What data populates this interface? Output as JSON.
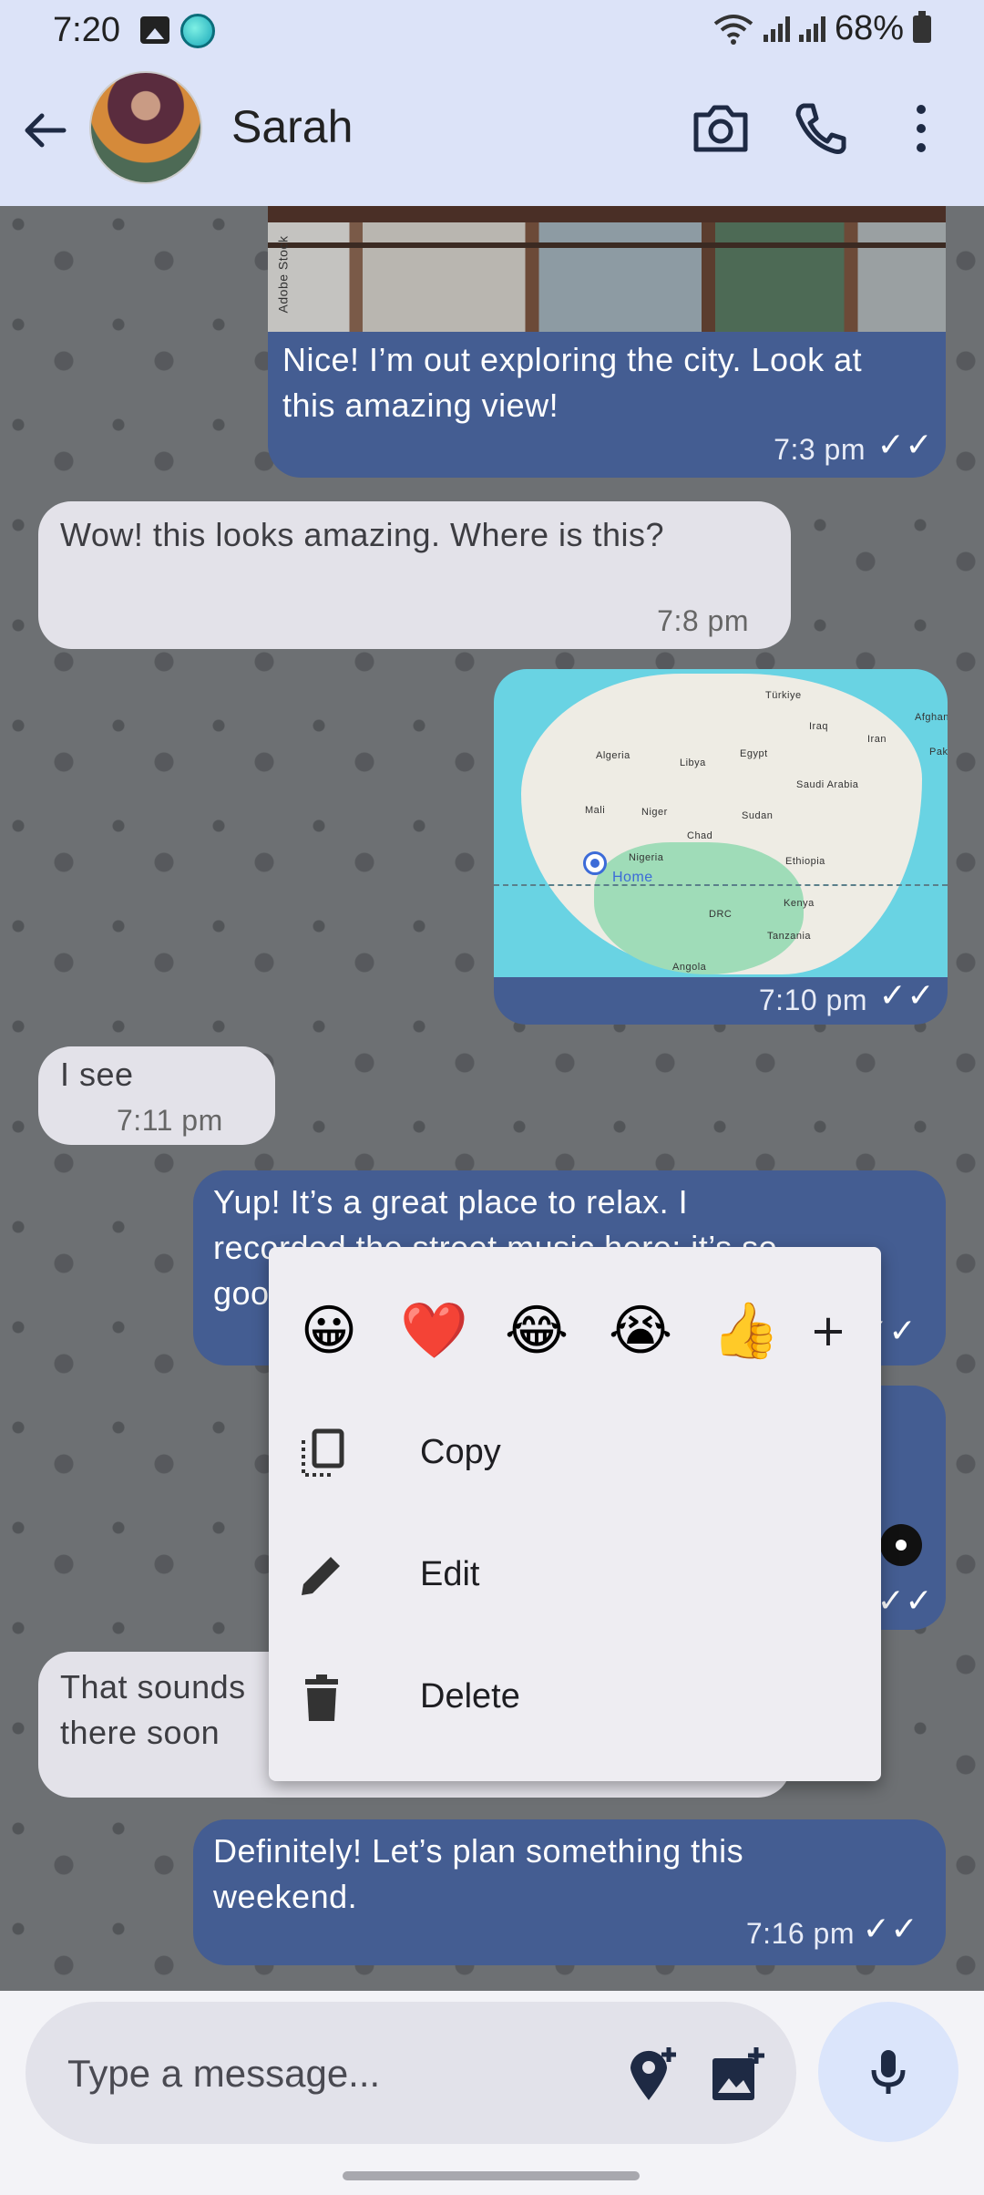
{
  "status_bar": {
    "time": "7:20",
    "battery": "68%"
  },
  "header": {
    "contact_name": "Sarah"
  },
  "messages": [
    {
      "id": "m1",
      "direction": "out",
      "text": "Nice! I’m out exploring the city. Look at this amazing view!",
      "time": "7:3 pm",
      "photo_watermark": "Adobe Stock"
    },
    {
      "id": "m2",
      "direction": "in",
      "text": "Wow! this looks amazing. Where is this?",
      "time": "7:8 pm"
    },
    {
      "id": "m3",
      "direction": "out",
      "type": "location",
      "time": "7:10 pm",
      "map": {
        "pin_label": "Home",
        "labels": [
          "Türkiye",
          "Iraq",
          "Iran",
          "Afghan",
          "Pak",
          "Algeria",
          "Libya",
          "Egypt",
          "Saudi Arabia",
          "Mali",
          "Niger",
          "Sudan",
          "Chad",
          "Nigeria",
          "Ethiopia",
          "Kenya",
          "DRC",
          "Tanzania",
          "Angola"
        ]
      }
    },
    {
      "id": "m4",
      "direction": "in",
      "text": "I see",
      "time": "7:11 pm"
    },
    {
      "id": "m5",
      "direction": "out",
      "text_line1": "Yup! It’s a great place to relax. I",
      "text_line2": "recorded the street music here; it’s so",
      "text_line3": "goo"
    },
    {
      "id": "m7",
      "direction": "in",
      "text_line1": "That sounds",
      "text_line2": "there soon"
    },
    {
      "id": "m8",
      "direction": "out",
      "text": "Definitely! Let’s plan something this weekend.",
      "time": "7:16 pm"
    }
  ],
  "context_menu": {
    "reactions": [
      "😀",
      "❤️",
      "😂",
      "😭",
      "👍"
    ],
    "more_reactions": "+",
    "items": [
      {
        "label": "Copy",
        "icon": "copy-icon"
      },
      {
        "label": "Edit",
        "icon": "edit-icon"
      },
      {
        "label": "Delete",
        "icon": "delete-icon"
      }
    ]
  },
  "composer": {
    "placeholder": "Type a message..."
  },
  "colors": {
    "outgoing_bubble": "#445d92",
    "incoming_bubble": "#e3e2e9",
    "header": "#dce3f8",
    "menu": "#eeedf2"
  }
}
